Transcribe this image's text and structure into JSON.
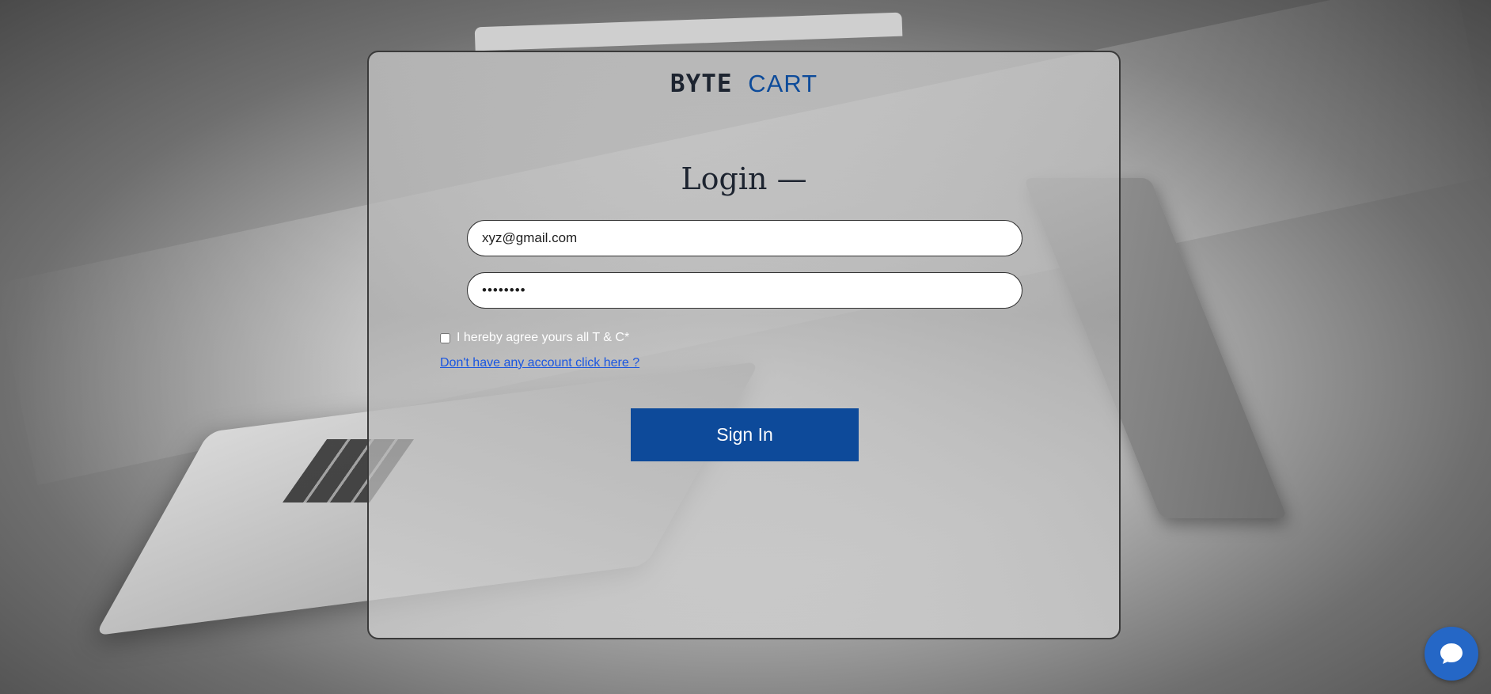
{
  "brand": {
    "part1": "BYTE",
    "part2": "CART"
  },
  "login": {
    "title": "Login —",
    "email_value": "xyz@gmail.com",
    "password_value": "••••••••",
    "terms_label": "I hereby agree yours all T & C*",
    "signup_link": "Don't have any account click here ?",
    "signin_button": "Sign In"
  },
  "chat": {
    "icon": "chat-bubble-icon"
  },
  "colors": {
    "brand_dark": "#1d2430",
    "brand_blue": "#0d4b9a",
    "button_blue": "#0d4a9a",
    "link_blue": "#1a56e0",
    "chat_blue": "#2567c6"
  }
}
